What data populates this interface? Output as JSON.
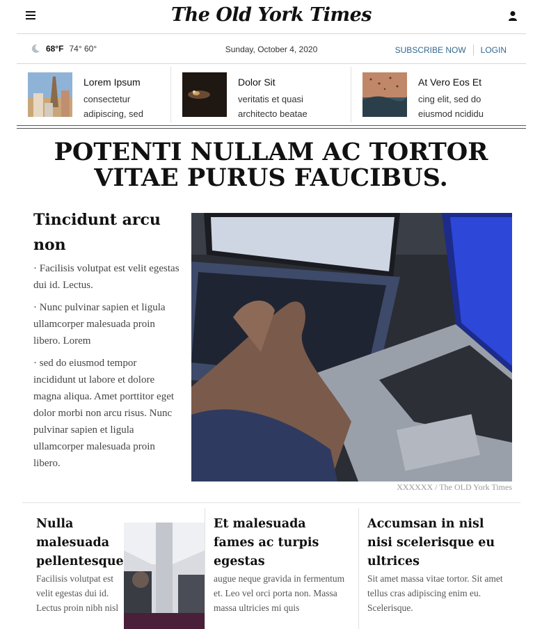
{
  "masthead": {
    "logo": "The Old York Times"
  },
  "infobar": {
    "temp": "68°F",
    "hilo": "74° 60°",
    "date": "Sunday, October 4, 2020",
    "subscribe": "SUBSCRIBE NOW",
    "login": "LOGIN"
  },
  "strip": [
    {
      "title": "Lorem Ipsum",
      "sub": "consectetur adipiscing, sed"
    },
    {
      "title": "Dolor Sit",
      "sub": "veritatis et quasi architecto beatae"
    },
    {
      "title": "At Vero Eos Et",
      "sub": "cing elit, sed do eiusmod ncididu"
    }
  ],
  "headline": "POTENTI NULLAM AC TORTOR VITAE PURUS FAUCIBUS.",
  "lead": {
    "title": "Tincidunt arcu non",
    "bullets": [
      "· Facilisis volutpat est velit egestas dui id. Lectus.",
      "· Nunc pulvinar sapien et ligula ullamcorper malesuada proin libero. Lorem",
      "· sed do eiusmod tempor incididunt ut labore et dolore magna aliqua. Amet porttitor eget dolor morbi non arcu risus. Nunc pulvinar sapien et ligula ullamcorper malesuada proin libero."
    ],
    "caption": "XXXXXX / The OLD York Times"
  },
  "columns": [
    {
      "title": "Nulla malesuada pellentesque",
      "body": "Facilisis volutpat est velit egestas dui id. Lectus proin nibh nisl"
    },
    {
      "title": "Et malesuada fames ac turpis egestas",
      "body": "augue neque gravida in fermentum et. Leo vel orci porta non. Massa massa ultricies mi quis"
    },
    {
      "title": "Accumsan in nisl nisi scelerisque eu ultrices",
      "body": "Sit amet massa vitae tortor. Sit amet tellus cras adipiscing enim eu. Scelerisque."
    }
  ],
  "icons": {
    "menu": "hamburger-menu-icon",
    "user": "user-icon",
    "weather": "moon-icon"
  },
  "colors": {
    "link": "#326891",
    "text": "#111111",
    "muted": "#555555"
  }
}
